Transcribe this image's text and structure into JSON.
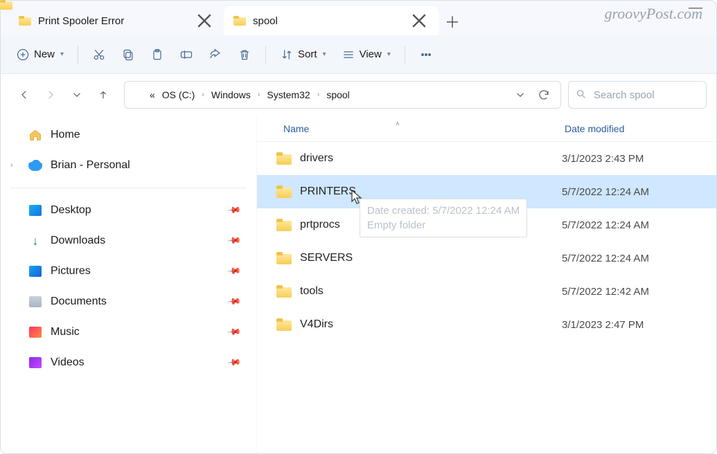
{
  "tabs": [
    {
      "title": "Print Spooler Error",
      "active": false
    },
    {
      "title": "spool",
      "active": true
    }
  ],
  "watermark": "groovyPost.com",
  "toolbar": {
    "new_label": "New",
    "sort_label": "Sort",
    "view_label": "View"
  },
  "breadcrumb": {
    "prefix": "«",
    "items": [
      "OS (C:)",
      "Windows",
      "System32",
      "spool"
    ]
  },
  "search": {
    "placeholder": "Search spool"
  },
  "sidebar": {
    "home": "Home",
    "onedrive": "Brian - Personal",
    "quick": [
      {
        "key": "desktop",
        "label": "Desktop"
      },
      {
        "key": "downloads",
        "label": "Downloads"
      },
      {
        "key": "pictures",
        "label": "Pictures"
      },
      {
        "key": "documents",
        "label": "Documents"
      },
      {
        "key": "music",
        "label": "Music"
      },
      {
        "key": "videos",
        "label": "Videos"
      }
    ]
  },
  "columns": {
    "name": "Name",
    "date": "Date modified"
  },
  "folders": [
    {
      "name": "drivers",
      "date": "3/1/2023 2:43 PM",
      "selected": false
    },
    {
      "name": "PRINTERS",
      "date": "5/7/2022 12:24 AM",
      "selected": true
    },
    {
      "name": "prtprocs",
      "date": "5/7/2022 12:24 AM",
      "selected": false
    },
    {
      "name": "SERVERS",
      "date": "5/7/2022 12:24 AM",
      "selected": false
    },
    {
      "name": "tools",
      "date": "5/7/2022 12:42 AM",
      "selected": false
    },
    {
      "name": "V4Dirs",
      "date": "3/1/2023 2:47 PM",
      "selected": false
    }
  ],
  "tooltip": {
    "line1": "Date created: 5/7/2022 12:24 AM",
    "line2": "Empty folder"
  }
}
